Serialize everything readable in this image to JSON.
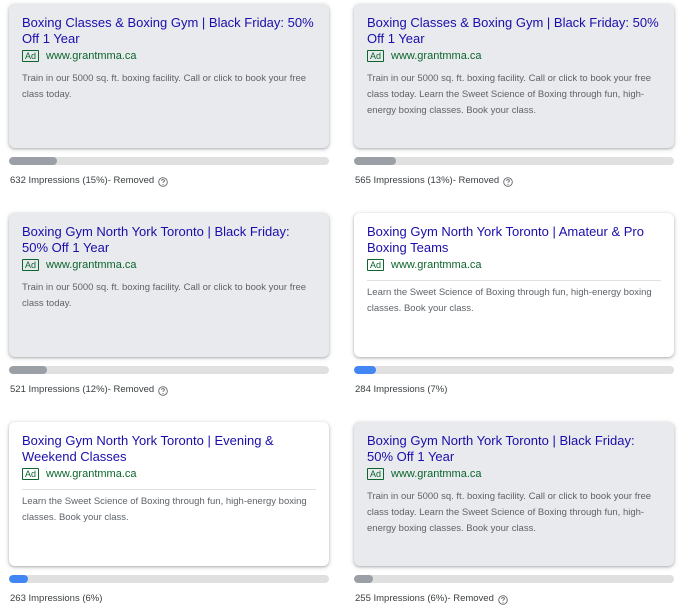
{
  "ads": [
    {
      "headline": "Boxing Classes & Boxing Gym | Black Friday: 50% Off 1 Year",
      "badge": "Ad",
      "url": "www.grantmma.ca",
      "description": "Train in our 5000 sq. ft. boxing facility. Call or click to book your free class today.",
      "impressions": "632 Impressions (15%)",
      "removed_label": " - Removed",
      "share": 15,
      "status": "removed"
    },
    {
      "headline": "Boxing Classes & Boxing Gym | Black Friday: 50% Off 1 Year",
      "badge": "Ad",
      "url": "www.grantmma.ca",
      "description": "Train in our 5000 sq. ft. boxing facility. Call or click to book your free class today. Learn the Sweet Science of Boxing through fun, high-energy boxing classes. Book your class.",
      "impressions": "565 Impressions (13%)",
      "removed_label": " - Removed",
      "share": 13,
      "status": "removed"
    },
    {
      "headline": "Boxing Gym North York Toronto | Black Friday: 50% Off 1 Year",
      "badge": "Ad",
      "url": "www.grantmma.ca",
      "description": "Train in our 5000 sq. ft. boxing facility. Call or click to book your free class today.",
      "impressions": "521 Impressions (12%)",
      "removed_label": " - Removed",
      "share": 12,
      "status": "removed"
    },
    {
      "headline": "Boxing Gym North York Toronto | Amateur & Pro Boxing Teams",
      "badge": "Ad",
      "url": "www.grantmma.ca",
      "description": "Learn the Sweet Science of Boxing through fun, high-energy boxing classes. Book your class.",
      "impressions": "284 Impressions (7%)",
      "removed_label": "",
      "share": 7,
      "status": "active"
    },
    {
      "headline": "Boxing Gym North York Toronto | Evening & Weekend Classes",
      "badge": "Ad",
      "url": "www.grantmma.ca",
      "description": "Learn the Sweet Science of Boxing through fun, high-energy boxing classes. Book your class.",
      "impressions": "263 Impressions (6%)",
      "removed_label": "",
      "share": 6,
      "status": "active"
    },
    {
      "headline": "Boxing Gym North York Toronto | Black Friday: 50% Off 1 Year",
      "badge": "Ad",
      "url": "www.grantmma.ca",
      "description": "Train in our 5000 sq. ft. boxing facility. Call or click to book your free class today. Learn the Sweet Science of Boxing through fun, high-energy boxing classes. Book your class.",
      "impressions": "255 Impressions (6%)",
      "removed_label": " - Removed",
      "share": 6,
      "status": "removed"
    }
  ],
  "icons": {
    "help": "help-circle-icon"
  },
  "colors": {
    "headline": "#1a0dab",
    "url_green": "#0d652d",
    "removed_card_bg": "#e8eaed",
    "active_card_bg": "#ffffff",
    "bar_track": "#e0e0e0",
    "bar_removed": "#9aa0a6",
    "bar_active": "#4285f4"
  }
}
